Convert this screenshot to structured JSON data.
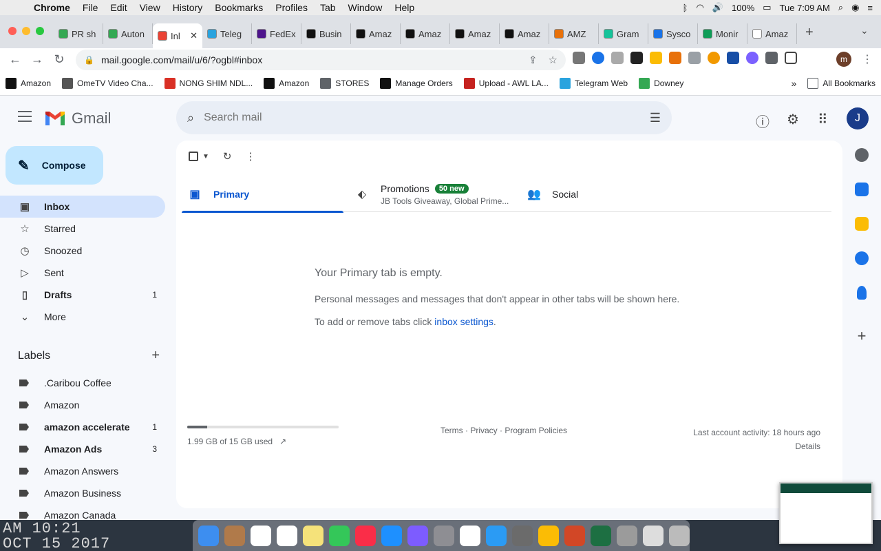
{
  "menubar": {
    "app": "Chrome",
    "items": [
      "File",
      "Edit",
      "View",
      "History",
      "Bookmarks",
      "Profiles",
      "Tab",
      "Window",
      "Help"
    ],
    "battery": "100%",
    "clock": "Tue 7:09 AM"
  },
  "tabs": [
    {
      "label": "PR sh",
      "color": "#34a853"
    },
    {
      "label": "Auton",
      "color": "#34a853"
    },
    {
      "label": "Inl",
      "color": "#ea4335",
      "active": true
    },
    {
      "label": "Teleg",
      "color": "#2aa3de"
    },
    {
      "label": "FedEx",
      "color": "#4d148c"
    },
    {
      "label": "Busin",
      "color": "#111111"
    },
    {
      "label": "Amaz",
      "color": "#111111"
    },
    {
      "label": "Amaz",
      "color": "#111111"
    },
    {
      "label": "Amaz",
      "color": "#111111"
    },
    {
      "label": "Amaz",
      "color": "#111111"
    },
    {
      "label": "AMZ",
      "color": "#e8710a"
    },
    {
      "label": "Gram",
      "color": "#15c39a"
    },
    {
      "label": "Sysco",
      "color": "#1a73e8"
    },
    {
      "label": "Monir",
      "color": "#0f9d58"
    },
    {
      "label": "Amaz",
      "color": "#ffffff"
    }
  ],
  "address": {
    "url": "mail.google.com/mail/u/6/?ogbl#inbox"
  },
  "bookmarks": [
    {
      "label": "Amazon",
      "color": "#111111"
    },
    {
      "label": "OmeTV Video Cha...",
      "color": "#555555"
    },
    {
      "label": "NONG SHIM NDL...",
      "color": "#d93025"
    },
    {
      "label": "Amazon",
      "color": "#111111"
    },
    {
      "label": "STORES",
      "color": "#5f6368"
    },
    {
      "label": "Manage Orders",
      "color": "#111111"
    },
    {
      "label": "Upload - AWL LA...",
      "color": "#c5221f"
    },
    {
      "label": "Telegram Web",
      "color": "#2aa3de"
    },
    {
      "label": "Downey",
      "color": "#34a853"
    }
  ],
  "bookmarks_all": "All Bookmarks",
  "gmail": {
    "brand": "Gmail",
    "search_placeholder": "Search mail",
    "avatar": "J",
    "compose": "Compose",
    "nav": [
      {
        "label": "Inbox",
        "icon": "inbox-icon",
        "glyph": "▣",
        "active": true,
        "count": ""
      },
      {
        "label": "Starred",
        "icon": "star-icon",
        "glyph": "☆",
        "count": ""
      },
      {
        "label": "Snoozed",
        "icon": "clock-icon",
        "glyph": "◷",
        "count": ""
      },
      {
        "label": "Sent",
        "icon": "send-icon",
        "glyph": "▷",
        "count": ""
      },
      {
        "label": "Drafts",
        "icon": "draft-icon",
        "glyph": "▯",
        "bold": true,
        "count": "1"
      },
      {
        "label": "More",
        "icon": "chevron-down-icon",
        "glyph": "⌄",
        "count": ""
      }
    ],
    "labels_heading": "Labels",
    "labels": [
      {
        "label": ".Caribou Coffee",
        "count": ""
      },
      {
        "label": "Amazon",
        "count": ""
      },
      {
        "label": "amazon accelerate",
        "count": "1",
        "bold": true
      },
      {
        "label": "Amazon Ads",
        "count": "3",
        "bold": true
      },
      {
        "label": "Amazon Answers",
        "count": ""
      },
      {
        "label": "Amazon Business",
        "count": ""
      },
      {
        "label": "Amazon Canada",
        "count": ""
      }
    ],
    "inbox_tabs": {
      "primary": "Primary",
      "promotions": "Promotions",
      "promotions_badge": "50 new",
      "promotions_snippet": "JB Tools Giveaway, Global Prime...",
      "social": "Social"
    },
    "empty": {
      "title": "Your Primary tab is empty.",
      "description": "Personal messages and messages that don't appear in other tabs will be shown here.",
      "tabs_prefix": "To add or remove tabs click ",
      "tabs_link": "inbox settings",
      "tabs_suffix": "."
    },
    "storage": {
      "text": "1.99 GB of 15 GB used",
      "fraction": 0.133
    },
    "footer": "Terms · Privacy · Program Policies",
    "activity": "Last account activity: 18 hours ago",
    "details": "Details"
  },
  "desktop": {
    "line1": "AM 10:21",
    "line2": "OCT 15 2017"
  },
  "dock_colors": [
    "#3d8ef0",
    "#b07a4a",
    "#ffffff",
    "#ffffff",
    "#f5e27a",
    "#34c759",
    "#fa2d48",
    "#1e90ff",
    "#7d5cff",
    "#8e8e93",
    "#ffffff",
    "#2b9bf4",
    "#6b6b6b",
    "#fbbc05",
    "#d24726",
    "#1d6f42",
    "#9b9b9b",
    "#dddddd",
    "#bbbbbb"
  ],
  "colors": {
    "accent": "#0b57d0",
    "compose_bg": "#c2e7ff",
    "active_nav": "#d3e3fd",
    "badge_green": "#188038"
  }
}
